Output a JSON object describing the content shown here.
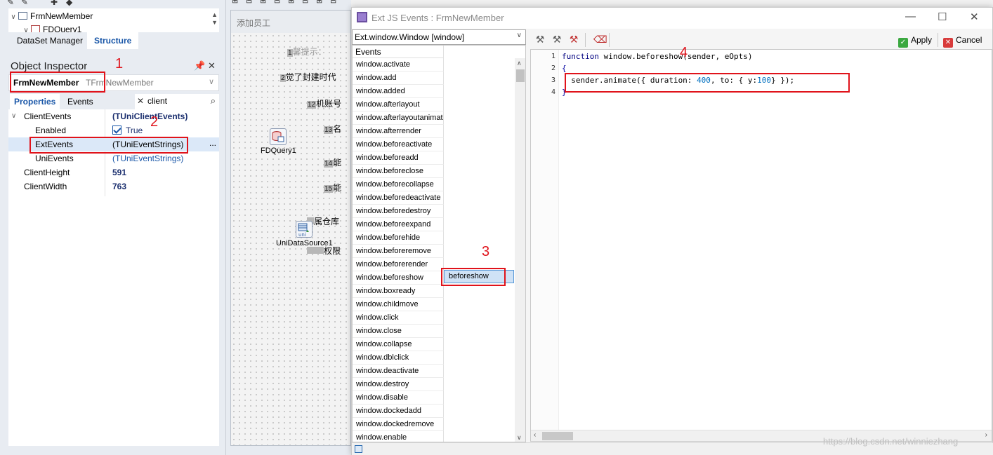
{
  "tree": {
    "root": "FrmNewMember",
    "child": "FDQuery1"
  },
  "dataset_tabs": [
    "DataSet Manager",
    "Structure"
  ],
  "object_inspector": {
    "title": "Object Inspector",
    "selected_name": "FrmNewMember",
    "selected_type": "TFrmNewMember",
    "tabs": [
      "Properties",
      "Events"
    ],
    "search": "client",
    "properties": [
      {
        "name": "ClientEvents",
        "value": "(TUniClientEvents)"
      },
      {
        "name": "Enabled",
        "value": "True"
      },
      {
        "name": "ExtEvents",
        "value": "(TUniEventStrings)",
        "ellipsis": "..."
      },
      {
        "name": "UniEvents",
        "value": "(TUniEventStrings)"
      },
      {
        "name": "ClientHeight",
        "value": "591"
      },
      {
        "name": "ClientWidth",
        "value": "763"
      }
    ]
  },
  "form": {
    "caption": "添加员工",
    "labels": [
      {
        "num": "1",
        "text": "馨提示："
      },
      {
        "num": "2",
        "text": "觉了封建时代"
      },
      {
        "num": "12",
        "text": "机账号"
      },
      {
        "num": "13",
        "text": "名"
      },
      {
        "num": "14",
        "text": "能"
      },
      {
        "num": "15",
        "text": "能"
      },
      {
        "num": "",
        "text": "属仓库"
      },
      {
        "num": "",
        "text": "权限"
      }
    ],
    "components": [
      "FDQuery1",
      "UniDataSource1"
    ]
  },
  "dialog": {
    "title": "Ext JS Events : FrmNewMember",
    "class_selector": "Ext.window.Window [window]",
    "events_header": "Events",
    "events": [
      "window.activate",
      "window.add",
      "window.added",
      "window.afterlayout",
      "window.afterlayoutanimation",
      "window.afterrender",
      "window.beforeactivate",
      "window.beforeadd",
      "window.beforeclose",
      "window.beforecollapse",
      "window.beforedeactivate",
      "window.beforedestroy",
      "window.beforeexpand",
      "window.beforehide",
      "window.beforeremove",
      "window.beforerender",
      "window.beforeshow",
      "window.boxready",
      "window.childmove",
      "window.click",
      "window.close",
      "window.collapse",
      "window.dblclick",
      "window.deactivate",
      "window.destroy",
      "window.disable",
      "window.dockedadd",
      "window.dockedremove",
      "window.enable"
    ],
    "selected_handler": "beforeshow",
    "apply_label": "Apply",
    "cancel_label": "Cancel",
    "code": {
      "line_numbers": [
        "1",
        "2",
        "3",
        "4"
      ],
      "line1_kw": "function",
      "line1_rest": " window.beforeshow(sender, eOpts)",
      "line2": "{",
      "line3_a": "  sender.animate({ duration: ",
      "line3_num1": "400",
      "line3_b": ", to: { y:",
      "line3_num2": "100",
      "line3_c": "} });",
      "line4": "}"
    }
  },
  "annotations": [
    "1",
    "2",
    "3",
    "4"
  ],
  "watermark": "https://blog.csdn.net/winniezhang"
}
